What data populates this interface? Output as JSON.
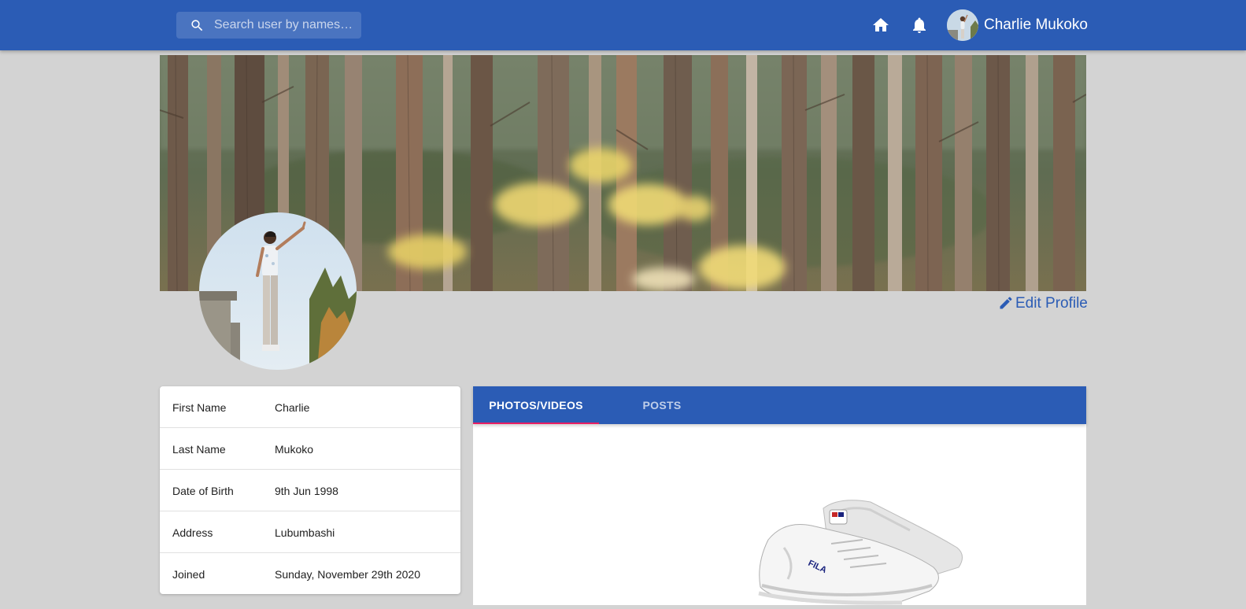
{
  "appbar": {
    "search_placeholder": "Search user by names…",
    "icons": [
      "search-icon",
      "home-icon",
      "notifications-icon"
    ],
    "user_name": "Charlie Mukoko"
  },
  "profile": {
    "edit_label": "Edit Profile"
  },
  "info": {
    "rows": [
      {
        "label": "First Name",
        "value": "Charlie"
      },
      {
        "label": "Last Name",
        "value": "Mukoko"
      },
      {
        "label": "Date of Birth",
        "value": "9th Jun 1998"
      },
      {
        "label": "Address",
        "value": "Lubumbashi"
      },
      {
        "label": "Joined",
        "value": "Sunday, November 29th 2020"
      }
    ]
  },
  "tabs": [
    {
      "label": "PHOTOS/VIDEOS",
      "active": true
    },
    {
      "label": "POSTS",
      "active": false
    }
  ],
  "colors": {
    "primary": "#2b5cb5",
    "tab_indicator": "#e91e63",
    "page_background": "#d3d3d3"
  }
}
